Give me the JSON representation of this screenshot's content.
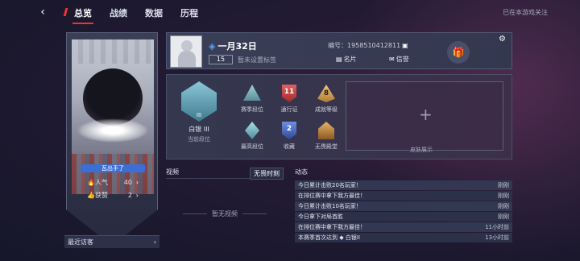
{
  "nav": {
    "back_icon": "back-arrow-icon",
    "tabs": [
      {
        "label": "总览",
        "active": true
      },
      {
        "label": "战绩",
        "active": false
      },
      {
        "label": "数据",
        "active": false
      },
      {
        "label": "历程",
        "active": false
      }
    ],
    "watching_text": "已在本游戏关注"
  },
  "left_card": {
    "out_button": "瓦出手了",
    "popularity": {
      "label": "人气",
      "value": "40"
    },
    "likes": {
      "label": "获赞",
      "value": "2"
    },
    "recent_visitors": "最近访客"
  },
  "profile": {
    "name": "一月32日",
    "level": "15",
    "tag_placeholder": "暂未设置标签",
    "id_label": "编号：1958510412811",
    "card_button": "名片",
    "mail_button": "信誉"
  },
  "ranks": {
    "main": {
      "name": "白银 III",
      "sub": "当前段位",
      "tier": "III"
    },
    "season": "赛季段位",
    "pass": {
      "label": "通行证",
      "value": "11"
    },
    "growth": {
      "label": "成就等级",
      "value": "8"
    },
    "highest": "最高段位",
    "collection": {
      "label": "收藏",
      "value": "2"
    },
    "fearless": "无畏殿堂",
    "skin_label": "皮肤展示"
  },
  "video": {
    "title": "视频",
    "filter": "无畏时刻",
    "empty": "暂无视频"
  },
  "news": {
    "title": "动态",
    "items": [
      {
        "text": "今日累计击败20名玩家！",
        "time": "刚刚"
      },
      {
        "text": "在排位赛中拿下我方最佳！",
        "time": "刚刚"
      },
      {
        "text": "今日累计击败10名玩家！",
        "time": "刚刚"
      },
      {
        "text": "今日拿下对局首胜",
        "time": "刚刚"
      },
      {
        "text": "在排位赛中拿下我方最佳！",
        "time": "11小时前"
      },
      {
        "text": "本赛季首次达到 ◆ 白银II",
        "time": "13小时前"
      }
    ]
  },
  "colors": {
    "accent_red": "#e33333",
    "rank_blue": "#5a9cf0",
    "button_blue": "#3b6fd6"
  }
}
